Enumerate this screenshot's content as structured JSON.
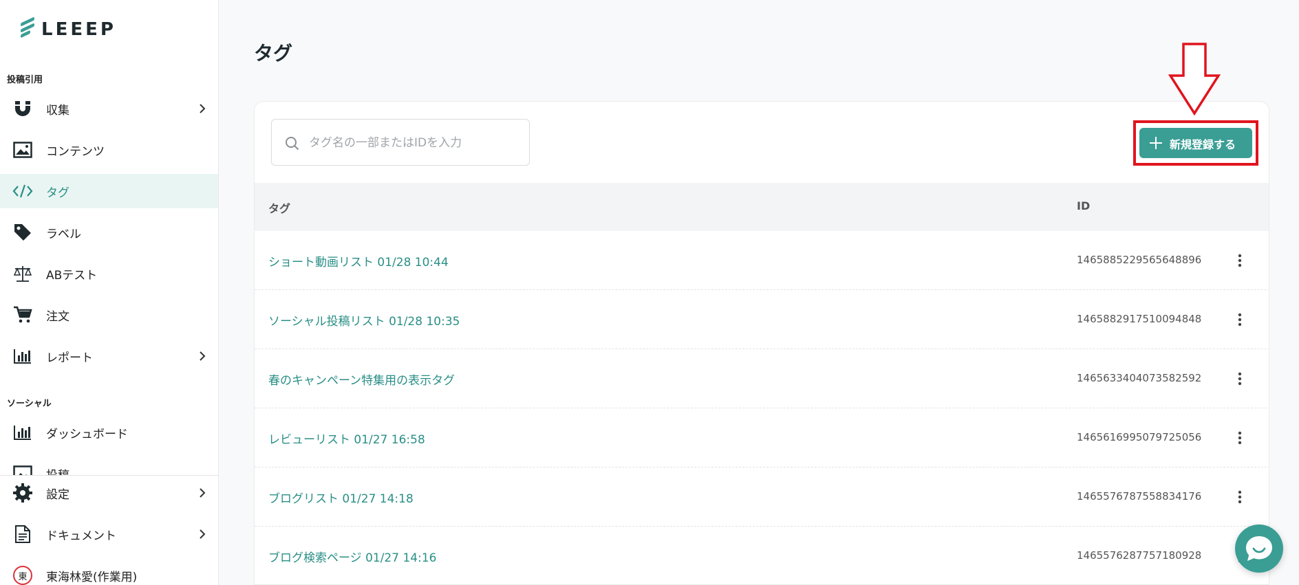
{
  "brand": {
    "logo_text": "LEEEP",
    "accent_color": "#3a9e95"
  },
  "sidebar": {
    "section_post": "投稿引用",
    "section_social": "ソーシャル",
    "items": [
      {
        "label": "収集",
        "icon": "magnet-icon",
        "has_chevron": true
      },
      {
        "label": "コンテンツ",
        "icon": "image-icon",
        "has_chevron": false
      },
      {
        "label": "タグ",
        "icon": "code-icon",
        "has_chevron": false,
        "active": true
      },
      {
        "label": "ラベル",
        "icon": "tag-icon",
        "has_chevron": false
      },
      {
        "label": "ABテスト",
        "icon": "scale-icon",
        "has_chevron": false
      },
      {
        "label": "注文",
        "icon": "cart-icon",
        "has_chevron": false
      },
      {
        "label": "レポート",
        "icon": "bar-chart-icon",
        "has_chevron": true
      },
      {
        "label": "ダッシュボード",
        "icon": "bar-chart-icon",
        "has_chevron": false
      },
      {
        "label": "投稿",
        "icon": "image-icon",
        "has_chevron": false
      }
    ],
    "bottom": [
      {
        "label": "設定",
        "icon": "gear-icon"
      },
      {
        "label": "ドキュメント",
        "icon": "document-icon"
      },
      {
        "label": "東海林愛(作業用)",
        "icon": "avatar",
        "avatar_char": "東"
      }
    ]
  },
  "main": {
    "title": "タグ",
    "search_placeholder": "タグ名の一部またはIDを入力",
    "add_button_label": "新規登録する",
    "table": {
      "columns": [
        "タグ",
        "ID"
      ],
      "rows": [
        {
          "name": "ショート動画リスト 01/28 10:44",
          "id": "1465885229565648896"
        },
        {
          "name": "ソーシャル投稿リスト 01/28 10:35",
          "id": "1465882917510094848"
        },
        {
          "name": "春のキャンペーン特集用の表示タグ",
          "id": "1465633404073582592"
        },
        {
          "name": "レビューリスト 01/27 16:58",
          "id": "1465616995079725056"
        },
        {
          "name": "ブログリスト 01/27 14:18",
          "id": "1465576787558834176"
        },
        {
          "name": "ブログ検索ページ 01/27 14:16",
          "id": "1465576287757180928"
        }
      ]
    }
  },
  "annotation": {
    "color": "#e0141e"
  }
}
